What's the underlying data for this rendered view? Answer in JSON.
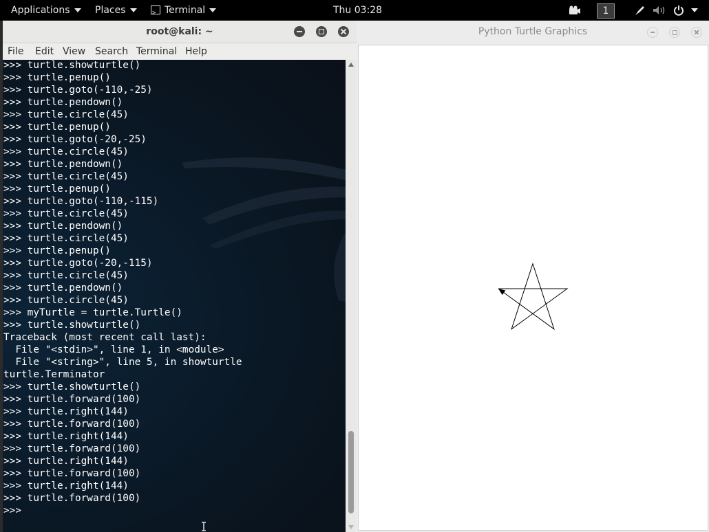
{
  "topbar": {
    "applications": "Applications",
    "places": "Places",
    "terminal": "Terminal",
    "clock": "Thu 03:28",
    "workspace": "1",
    "icons": [
      "camera-icon",
      "pen-icon",
      "volume-icon",
      "power-icon"
    ]
  },
  "terminal_window": {
    "title": "root@kali: ~",
    "menu": [
      "File",
      "Edit",
      "View",
      "Search",
      "Terminal",
      "Help"
    ],
    "lines": [
      ">>> turtle.showturtle()",
      ">>> turtle.penup()",
      ">>> turtle.goto(-110,-25)",
      ">>> turtle.pendown()",
      ">>> turtle.circle(45)",
      ">>> turtle.penup()",
      ">>> turtle.goto(-20,-25)",
      ">>> turtle.circle(45)",
      ">>> turtle.pendown()",
      ">>> turtle.circle(45)",
      ">>> turtle.penup()",
      ">>> turtle.goto(-110,-115)",
      ">>> turtle.circle(45)",
      ">>> turtle.pendown()",
      ">>> turtle.circle(45)",
      ">>> turtle.penup()",
      ">>> turtle.goto(-20,-115)",
      ">>> turtle.circle(45)",
      ">>> turtle.pendown()",
      ">>> turtle.circle(45)",
      ">>> myTurtle = turtle.Turtle()",
      ">>> turtle.showturtle()",
      "Traceback (most recent call last):",
      "  File \"<stdin>\", line 1, in <module>",
      "  File \"<string>\", line 5, in showturtle",
      "turtle.Terminator",
      ">>> turtle.showturtle()",
      ">>> turtle.forward(100)",
      ">>> turtle.right(144)",
      ">>> turtle.forward(100)",
      ">>> turtle.right(144)",
      ">>> turtle.forward(100)",
      ">>> turtle.right(144)",
      ">>> turtle.forward(100)",
      ">>> turtle.right(144)",
      ">>> turtle.forward(100)",
      ">>> "
    ],
    "colors": {
      "text": "#ffffff",
      "background": "#0b1a2a"
    }
  },
  "turtle_window": {
    "title": "Python Turtle Graphics",
    "drawing": {
      "shape": "star",
      "forward": 100,
      "turn_right_deg": 144,
      "repeats": 5,
      "stroke": "#000000"
    }
  }
}
